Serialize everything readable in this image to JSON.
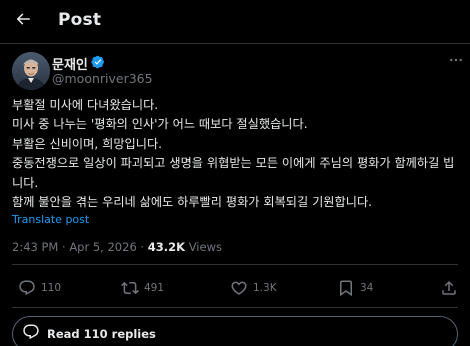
{
  "header": {
    "title": "Post",
    "back_icon": "arrow-left-icon"
  },
  "author": {
    "display_name": "문재인",
    "handle": "@moonriver365",
    "verified_icon": "verified-badge-icon",
    "verified_color": "#1d9bf0"
  },
  "post": {
    "lines": [
      "부활절 미사에 다녀왔습니다.",
      "미사 중 나누는 '평화의 인사'가 어느 때보다 절실했습니다.",
      "부활은 신비이며, 희망입니다.",
      "중동전쟁으로 일상이 파괴되고 생명을 위협받는 모든 이에게 주님의 평화가 함께하길 빕",
      "니다.",
      "함께 불안을 겪는 우리네 삶에도 하루빨리 평화가 회복되길 기원합니다."
    ],
    "translate_label": "Translate post"
  },
  "meta": {
    "time": "2:43 PM",
    "separator": "·",
    "date": "Apr 5, 2026",
    "views_count": "43.2K",
    "views_label": "Views"
  },
  "actions": {
    "reply_count": "110",
    "repost_count": "491",
    "like_count": "1.3K",
    "bookmark_count": "34",
    "icons": [
      "reply-icon",
      "repost-icon",
      "like-icon",
      "bookmark-icon",
      "share-icon"
    ]
  },
  "replies": {
    "label": "Read 110 replies",
    "icon": "reply-icon"
  },
  "colors": {
    "background": "#000000",
    "text": "#e7e9ea",
    "muted": "#71767b",
    "link": "#1d9bf0",
    "divider": "#2f3336"
  }
}
